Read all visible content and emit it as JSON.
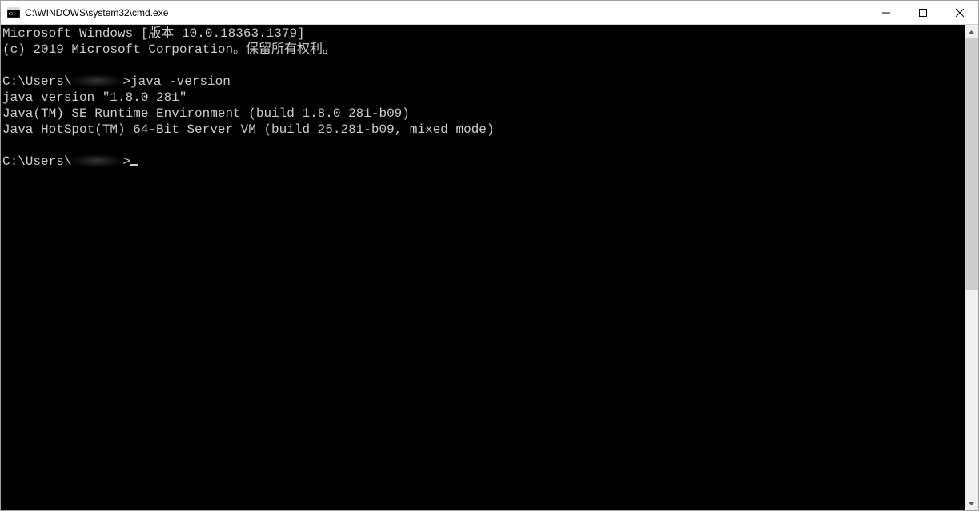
{
  "titlebar": {
    "title": "C:\\WINDOWS\\system32\\cmd.exe"
  },
  "console": {
    "header_line": "Microsoft Windows [版本 10.0.18363.1379]",
    "copyright_line": "(c) 2019 Microsoft Corporation。保留所有权利。",
    "prompt_prefix": "C:\\Users\\",
    "prompt_suffix": ">",
    "command": "java -version",
    "output_lines": [
      "java version \"1.8.0_281\"",
      "Java(TM) SE Runtime Environment (build 1.8.0_281-b09)",
      "Java HotSpot(TM) 64-Bit Server VM (build 25.281-b09, mixed mode)"
    ]
  },
  "scrollbar": {
    "thumb_top_pct": 0,
    "thumb_height_pct": 55
  }
}
